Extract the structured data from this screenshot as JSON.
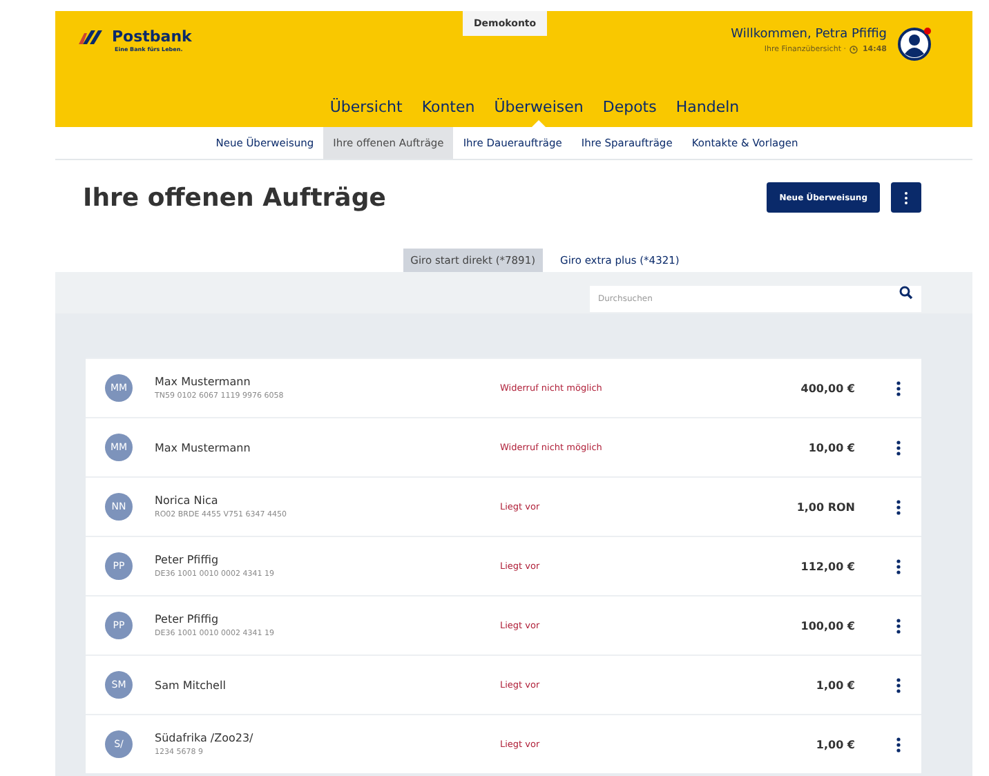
{
  "header": {
    "demo_badge": "Demokonto",
    "logo": {
      "name": "Postbank",
      "tagline": "Eine Bank fürs Leben."
    },
    "welcome": "Willkommen, Petra Pfiffig",
    "overview": "Ihre Finanzübersicht ·",
    "time": "14:48",
    "notification": true
  },
  "main_nav": [
    {
      "label": "Übersicht",
      "selected": false
    },
    {
      "label": "Konten",
      "selected": false
    },
    {
      "label": "Überweisen",
      "selected": true
    },
    {
      "label": "Depots",
      "selected": false
    },
    {
      "label": "Handeln",
      "selected": false
    }
  ],
  "sub_nav": [
    {
      "label": "Neue Überweisung",
      "selected": false
    },
    {
      "label": "Ihre offenen Aufträge",
      "selected": true
    },
    {
      "label": "Ihre Daueraufträge",
      "selected": false
    },
    {
      "label": "Ihre Sparaufträge",
      "selected": false
    },
    {
      "label": "Kontakte & Vorlagen",
      "selected": false
    }
  ],
  "page": {
    "title": "Ihre offenen Aufträge",
    "new_button": "Neue Überweisung"
  },
  "accounts": [
    {
      "label": "Giro start direkt (*7891)",
      "selected": true
    },
    {
      "label": "Giro extra plus (*4321)",
      "selected": false
    }
  ],
  "search": {
    "placeholder": "Durchsuchen"
  },
  "orders": [
    {
      "initials": "MM",
      "name": "Max Mustermann",
      "iban": "TN59 0102 6067 1119 9976 6058",
      "status": "Widerruf nicht möglich",
      "amount": "400,00 €"
    },
    {
      "initials": "MM",
      "name": "Max Mustermann",
      "status": "Widerruf nicht möglich",
      "amount": "10,00 €"
    },
    {
      "initials": "NN",
      "name": "Norica Nica",
      "iban": "RO02 BRDE 4455 V751 6347 4450",
      "status": "Liegt vor",
      "amount": "1,00 RON"
    },
    {
      "initials": "PP",
      "name": "Peter Pfiffig",
      "iban": "DE36 1001 0010 0002 4341 19",
      "status": "Liegt vor",
      "amount": "112,00 €"
    },
    {
      "initials": "PP",
      "name": "Peter Pfiffig",
      "iban": "DE36 1001 0010 0002 4341 19",
      "status": "Liegt vor",
      "amount": "100,00 €"
    },
    {
      "initials": "SM",
      "name": "Sam Mitchell",
      "status": "Liegt vor",
      "amount": "1,00 €"
    },
    {
      "initials": "S/",
      "name": "Südafrika /Zoo23/",
      "iban": "1234 5678 9",
      "status": "Liegt vor",
      "amount": "1,00 €"
    }
  ]
}
